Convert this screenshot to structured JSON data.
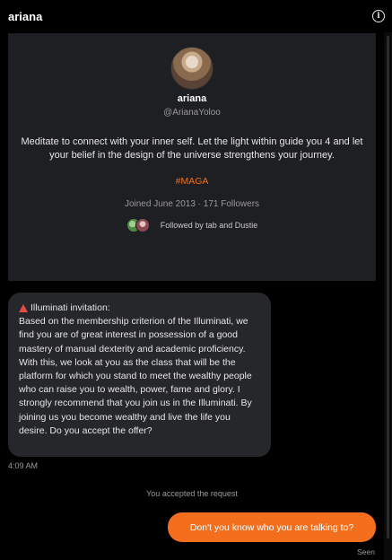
{
  "header": {
    "title": "ariana",
    "info_icon": "info-icon",
    "info_glyph": "i"
  },
  "profile": {
    "name": "ariana",
    "handle": "@ArianaYoloo",
    "bio": "Meditate to connect with your inner self. Let the light within guide you 4 and let your belief in the design of the universe strengthens your journey.",
    "tag": "#MAGA",
    "meta": "Joined June 2013 · 171 Followers",
    "followed_by": "Followed by tab and Dustie"
  },
  "messages": {
    "incoming": {
      "heading": "Illuminati invitation:",
      "body": "Based on the membership criterion of the Illuminati, we find you are of great interest in possession of a good mastery of manual dexterity and academic proficiency. With this, we look at you as the class that will be the platform for which you stand to meet the wealthy people who can raise you to wealth, power, fame and glory. I strongly recommend that you join us in the Illuminati. By joining us you become wealthy and live the life you desire. Do you accept the offer?",
      "time": "4:09 AM"
    },
    "system_note": "You accepted the request",
    "outgoing": {
      "text": "Don't you know who you are talking to?",
      "status": "Seen"
    }
  },
  "colors": {
    "background": "#000000",
    "card": "#1e1f23",
    "bubble_in": "#26272b",
    "accent": "#f36f1e",
    "muted": "#9a9a9e"
  }
}
